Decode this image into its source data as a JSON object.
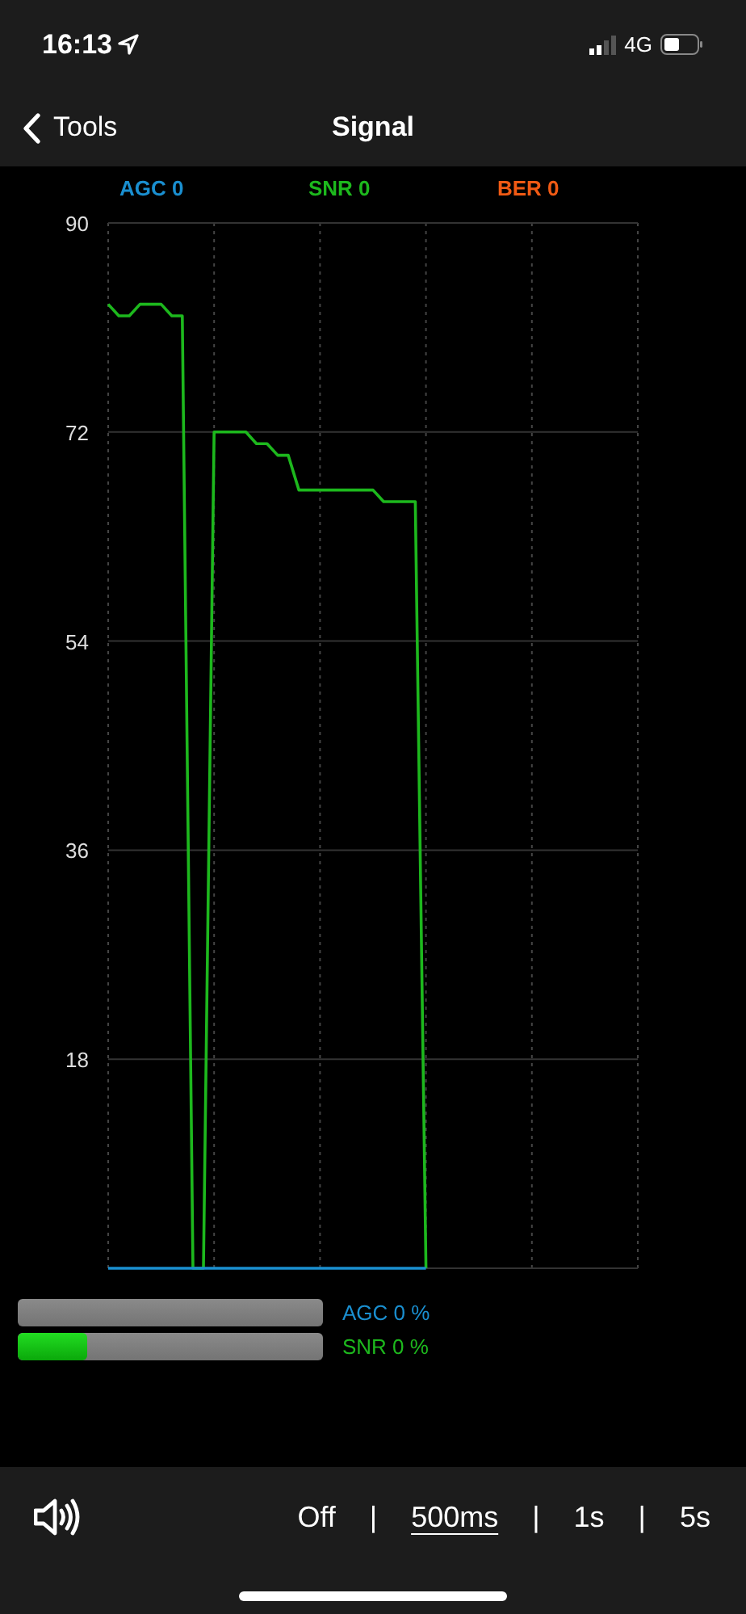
{
  "status_bar": {
    "time": "16:13",
    "network": "4G"
  },
  "nav": {
    "back": "Tools",
    "title": "Signal"
  },
  "legend": [
    {
      "label": "AGC 0",
      "color": "#1a8fd0"
    },
    {
      "label": "SNR 0",
      "color": "#1db81d"
    },
    {
      "label": "BER 0",
      "color": "#f05a14"
    }
  ],
  "chart": {
    "chart_data": {
      "type": "line",
      "categories": [
        null,
        null,
        null,
        null,
        null,
        null,
        null,
        null,
        null,
        null,
        null,
        null,
        null,
        null,
        null,
        null,
        null,
        null,
        null,
        null,
        null,
        null,
        null,
        null,
        null,
        null,
        null,
        null,
        null,
        null,
        null,
        null,
        null,
        null,
        null,
        null,
        null,
        null,
        null,
        null,
        null,
        null,
        null,
        null,
        null,
        null,
        null,
        null,
        null,
        null,
        null
      ],
      "ylim": [
        0,
        90
      ],
      "yticks": [
        18,
        36,
        54,
        72,
        90
      ],
      "grid": true,
      "series": [
        {
          "color": "#1db81d",
          "values": [
            83,
            82,
            82,
            83,
            83,
            83,
            82,
            82,
            0,
            0,
            72,
            72,
            72,
            72,
            71,
            71,
            70,
            70,
            67,
            67,
            67,
            67,
            67,
            67,
            67,
            67,
            66,
            66,
            66,
            66,
            0,
            null,
            null,
            null,
            null,
            null,
            null,
            null,
            null,
            null,
            null,
            null,
            null,
            null,
            null,
            null,
            null,
            null,
            null,
            null,
            null
          ]
        },
        {
          "color": "#1a8fd0",
          "values": [
            0,
            0,
            0,
            0,
            0,
            0,
            0,
            0,
            0,
            0,
            0,
            0,
            0,
            0,
            0,
            0,
            0,
            0,
            0,
            0,
            0,
            0,
            0,
            0,
            0,
            0,
            0,
            0,
            0,
            0,
            0,
            null,
            null,
            null,
            null,
            null,
            null,
            null,
            null,
            null,
            null,
            null,
            null,
            null,
            null,
            null,
            null,
            null,
            null,
            null,
            null
          ]
        }
      ]
    }
  },
  "meters": [
    {
      "label": "AGC 0 %",
      "color": "#1a8fd0",
      "level": 0
    },
    {
      "label": "SNR 0 %",
      "color": "#1db81d",
      "level": 0.23
    }
  ],
  "toolbar": {
    "intervals": [
      {
        "kind": "option",
        "label": "Off",
        "selected": false
      },
      {
        "kind": "separator",
        "label": "|"
      },
      {
        "kind": "option",
        "label": "500ms",
        "selected": true
      },
      {
        "kind": "separator",
        "label": "|"
      },
      {
        "kind": "option",
        "label": "1s",
        "selected": false
      },
      {
        "kind": "separator",
        "label": "|"
      },
      {
        "kind": "option",
        "label": "5s",
        "selected": false
      }
    ]
  }
}
